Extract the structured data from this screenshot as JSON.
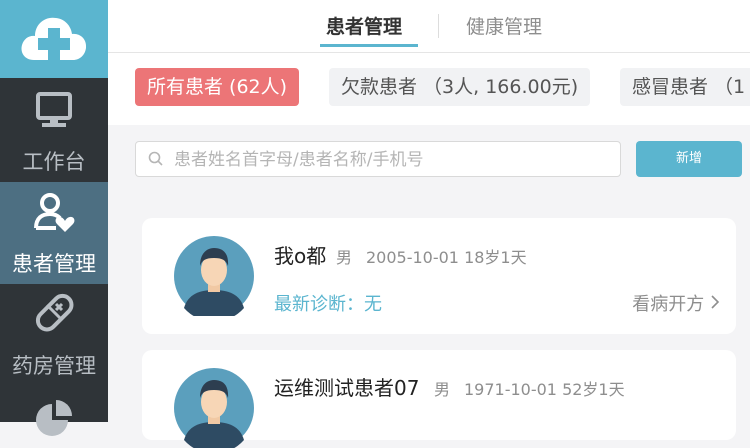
{
  "sidebar": {
    "items": [
      {
        "label": "工作台",
        "icon": "monitor-icon"
      },
      {
        "label": "患者管理",
        "icon": "patient-heart-icon"
      },
      {
        "label": "药房管理",
        "icon": "pill-icon"
      },
      {
        "label": "",
        "icon": "pie-chart-icon"
      }
    ]
  },
  "tabs": {
    "patient": "患者管理",
    "health": "健康管理"
  },
  "filters": {
    "all": "所有患者 (62人)",
    "debt": "欠款患者 （3人, 166.00元)",
    "cold": "感冒患者 （1"
  },
  "search": {
    "placeholder": "患者姓名首字母/患者名称/手机号",
    "value": ""
  },
  "add_button": "新增",
  "patients": [
    {
      "name": "我o都",
      "gender": "男",
      "birth": "2005-10-01 18岁1天",
      "diagnosis": "最新诊断：无",
      "action": "看病开方"
    },
    {
      "name": "运维测试患者07",
      "gender": "男",
      "birth": "1971-10-01 52岁1天"
    }
  ],
  "colors": {
    "accent": "#5bb5cf",
    "chip_active": "#ec7577",
    "sidebar_bg": "#2f3438",
    "sidebar_active": "#4d6f82"
  }
}
